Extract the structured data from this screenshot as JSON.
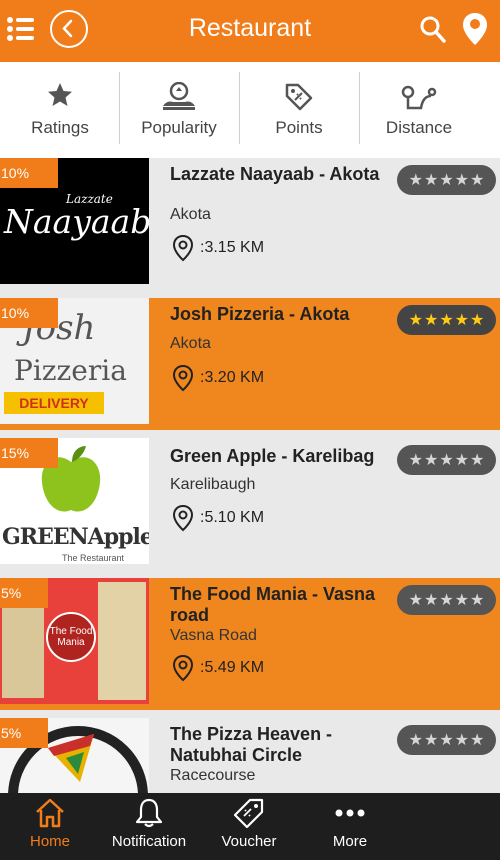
{
  "header": {
    "title": "Restaurant"
  },
  "sort_options": [
    {
      "label": "Ratings",
      "icon": "star-icon"
    },
    {
      "label": "Popularity",
      "icon": "popularity-icon"
    },
    {
      "label": "Points",
      "icon": "tag-icon"
    },
    {
      "label": "Distance",
      "icon": "route-icon"
    }
  ],
  "restaurants": [
    {
      "discount": "10%",
      "name": "Lazzate Naayaab - Akota",
      "area": "Akota",
      "distance": ":3.15 KM",
      "rating": 0,
      "logo_text": "Naayaab",
      "logo_small": "Lazzate"
    },
    {
      "discount": "10%",
      "name": "Josh Pizzeria - Akota",
      "area": "Akota",
      "distance": ":3.20 KM",
      "rating": 5,
      "logo_text": "Pizzeria",
      "logo_small": "Josh",
      "logo_extra": "DELIVERY"
    },
    {
      "discount": "15%",
      "name": "Green Apple - Karelibag",
      "area": "Karelibaugh",
      "distance": ":5.10 KM",
      "rating": 0,
      "logo_text": "GREENApple",
      "logo_small": "The Restaurant"
    },
    {
      "discount": "5%",
      "name": "The Food Mania - Vasna road",
      "area": "Vasna Road",
      "distance": ":5.49 KM",
      "rating": 0,
      "logo_text": "The Food Mania"
    },
    {
      "discount": "5%",
      "name": "The Pizza Heaven - Natubhai Circle",
      "area": "Racecourse",
      "distance": "",
      "rating": 0
    }
  ],
  "bottom_nav": [
    {
      "label": "Home",
      "icon": "home-icon",
      "active": true
    },
    {
      "label": "Notification",
      "icon": "bell-icon",
      "active": false
    },
    {
      "label": "Voucher",
      "icon": "voucher-icon",
      "active": false
    },
    {
      "label": "More",
      "icon": "more-icon",
      "active": false
    }
  ],
  "colors": {
    "accent": "#f07d1a",
    "card_alt": "#f0861e",
    "card_plain": "#e9e9e9",
    "nav_bg": "#1e1e1e",
    "star_gold": "#ffcb14"
  }
}
